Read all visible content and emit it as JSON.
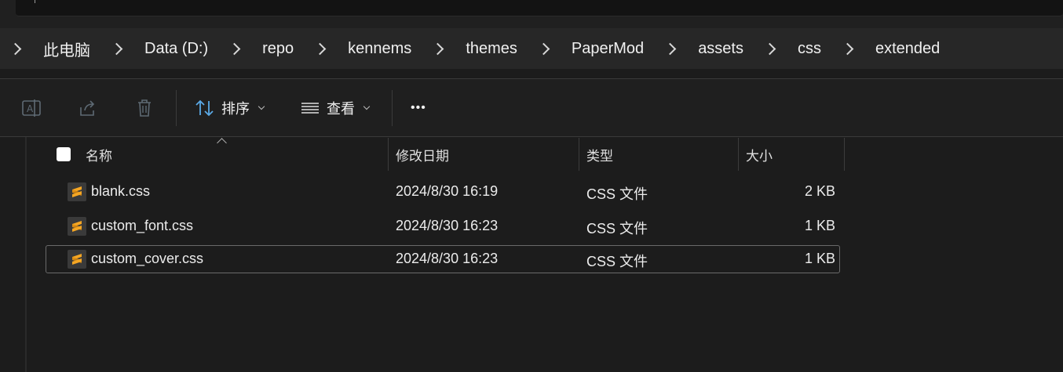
{
  "breadcrumb": [
    "此电脑",
    "Data (D:)",
    "repo",
    "kennems",
    "themes",
    "PaperMod",
    "assets",
    "css",
    "extended"
  ],
  "toolbar": {
    "sort_label": "排序",
    "view_label": "查看",
    "more_label": "•••"
  },
  "columns": {
    "name": "名称",
    "date": "修改日期",
    "type": "类型",
    "size": "大小"
  },
  "files": [
    {
      "name": "blank.css",
      "date": "2024/8/30 16:19",
      "type": "CSS 文件",
      "size": "2 KB"
    },
    {
      "name": "custom_font.css",
      "date": "2024/8/30 16:23",
      "type": "CSS 文件",
      "size": "1 KB"
    },
    {
      "name": "custom_cover.css",
      "date": "2024/8/30 16:23",
      "type": "CSS 文件",
      "size": "1 KB"
    }
  ],
  "colors": {
    "accent_icon": "#f5a623",
    "toolbar_icon_active": "#5aa9e6"
  }
}
